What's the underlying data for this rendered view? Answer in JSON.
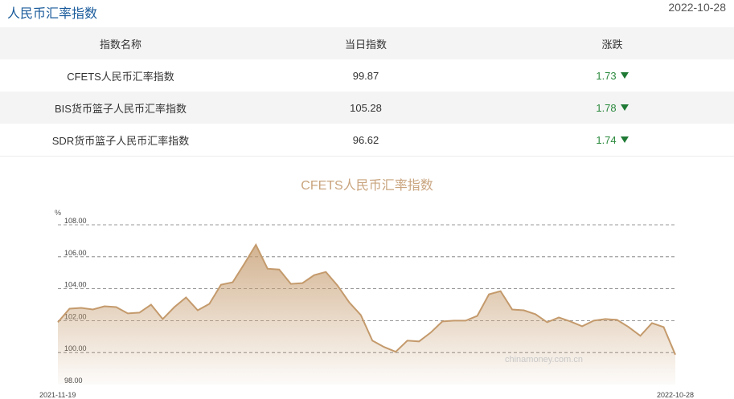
{
  "header": {
    "title": "人民币汇率指数",
    "date": "2022-10-28"
  },
  "table": {
    "columns": [
      "指数名称",
      "当日指数",
      "涨跌"
    ],
    "rows": [
      {
        "name": "CFETS人民币汇率指数",
        "value": "99.87",
        "change": "1.73"
      },
      {
        "name": "BIS货币篮子人民币汇率指数",
        "value": "105.28",
        "change": "1.78"
      },
      {
        "name": "SDR货币篮子人民币汇率指数",
        "value": "96.62",
        "change": "1.74"
      }
    ]
  },
  "colors": {
    "title": "#1a5b9b",
    "down": "#1f7a35",
    "line": "#c49a6c",
    "fill": "#c49a6c"
  },
  "chart_data": {
    "type": "area",
    "title": "CFETS人民币汇率指数",
    "ylabel": "%",
    "x_start": "2021-11-19",
    "x_end": "2022-10-28",
    "ylim": [
      98,
      108
    ],
    "yticks": [
      "98.00",
      "100.00",
      "102.00",
      "104.00",
      "106.00",
      "108.00"
    ],
    "grid": true,
    "watermark": "chinamoney.com.cn",
    "values": [
      101.9,
      102.75,
      102.8,
      102.7,
      102.9,
      102.85,
      102.45,
      102.5,
      103.0,
      102.1,
      102.85,
      103.45,
      102.65,
      103.05,
      104.25,
      104.4,
      105.55,
      106.75,
      105.25,
      105.2,
      104.3,
      104.35,
      104.85,
      105.05,
      104.2,
      103.15,
      102.35,
      100.75,
      100.35,
      100.05,
      100.75,
      100.7,
      101.25,
      101.95,
      102.0,
      102.0,
      102.3,
      103.65,
      103.85,
      102.7,
      102.65,
      102.4,
      101.9,
      102.2,
      101.95,
      101.65,
      102.0,
      102.1,
      102.05,
      101.6,
      101.05,
      101.85,
      101.6,
      99.87
    ]
  }
}
